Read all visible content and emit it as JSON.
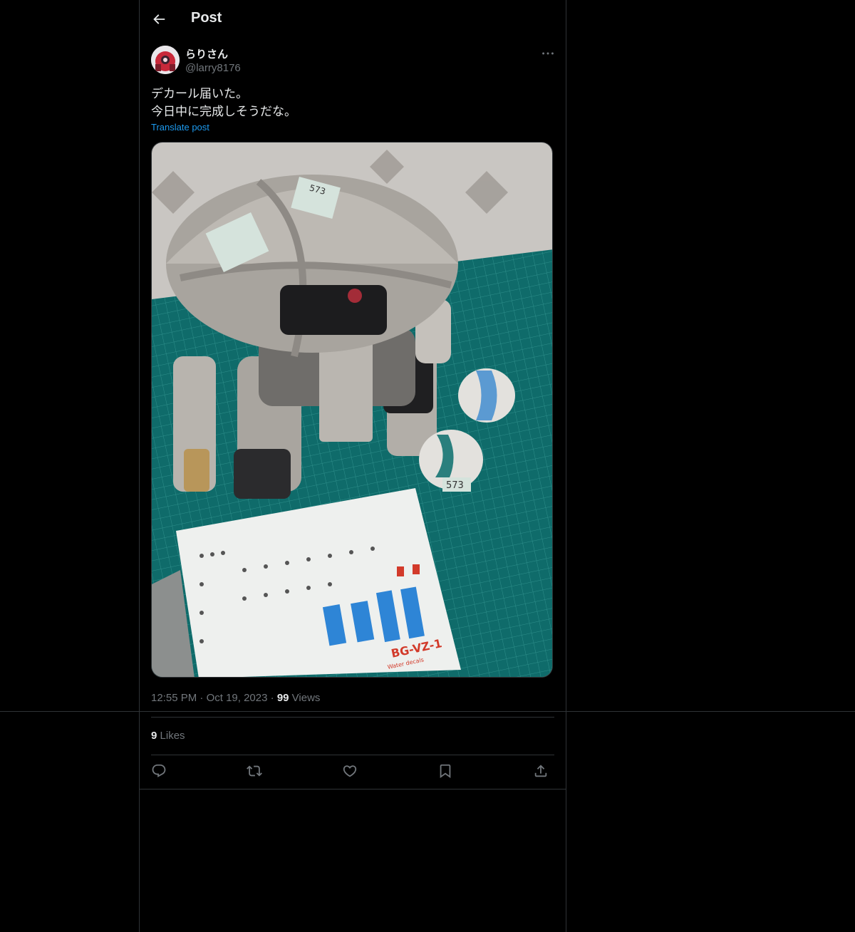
{
  "header": {
    "title": "Post"
  },
  "author": {
    "display_name": "らりさん",
    "handle": "@larry8176"
  },
  "tweet": {
    "lines": [
      "デカール届いた。",
      "今日中に完成しそうだな。"
    ],
    "translate_label": "Translate post"
  },
  "meta": {
    "time": "12:55 PM",
    "dot": "·",
    "date": "Oct 19, 2023",
    "views_count": "99",
    "views_label": "Views"
  },
  "engagement": {
    "likes_count": "9",
    "likes_label": "Likes"
  },
  "media_labels": {
    "model_number": "573",
    "decal_code": "BG-VZ-1",
    "brand": "Water decals"
  },
  "icons": {
    "back": "arrow-left-icon",
    "more": "more-horizontal-icon",
    "reply": "reply-icon",
    "repost": "repost-icon",
    "like": "heart-icon",
    "bookmark": "bookmark-icon",
    "share": "share-icon"
  },
  "colors": {
    "link": "#1d9bf0",
    "muted": "#71767b",
    "text": "#e7e9ea",
    "border": "#2f3336"
  }
}
